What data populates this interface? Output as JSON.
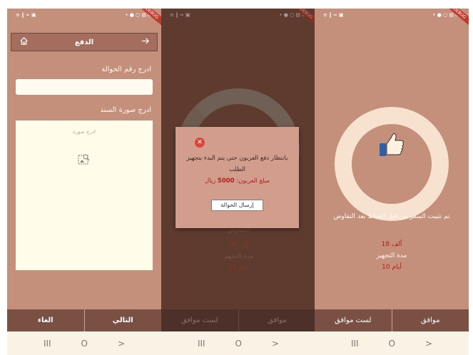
{
  "status": {
    "left": "≡ ‖ ≈ ▣",
    "right": "• ● ○ ▤ ₀₀:₁"
  },
  "ribbon": "DEBUG",
  "screen1": {
    "title": "الدفع",
    "transfer_label": "ادرج رقم الحوالة",
    "transfer_value": "",
    "receipt_label": "ادرج صورة السند",
    "image_caption": "ادرج صورة",
    "cancel_label": "الغاء",
    "next_label": "التالي"
  },
  "screen2": {
    "dialog_message": "بانتظار دفع العربون حتى يتم البدء بتجهيز الطلب",
    "deposit_label": "مبلغ العربون:",
    "deposit_amount": "5000",
    "deposit_currency": "ريال",
    "send_label": "إرسال الحوالة",
    "faded_negotiation": "التفاوض",
    "faded_price": "18 ألف",
    "faded_prep_label": "مدة التجهيز",
    "faded_prep_value": "10 أيام",
    "disagree_label": "لست موافق",
    "agree_label": "موافق"
  },
  "screen3": {
    "message": "تم تثبيت السعر من قبل الخياط بعد التفاوض",
    "price": "18 ألف",
    "prep_label": "مدة التجهيز",
    "prep_value": "10 أيام",
    "disagree_label": "لست موافق",
    "agree_label": "موافق"
  },
  "navbar": {
    "recents": "III",
    "home": "O",
    "back": ">"
  },
  "colors": {
    "background": "#c48f7b",
    "app_bar": "#a46d5d",
    "bottom_bar": "#7a5044",
    "red_text": "#b41f1a",
    "ring": "#f6e2cf"
  }
}
